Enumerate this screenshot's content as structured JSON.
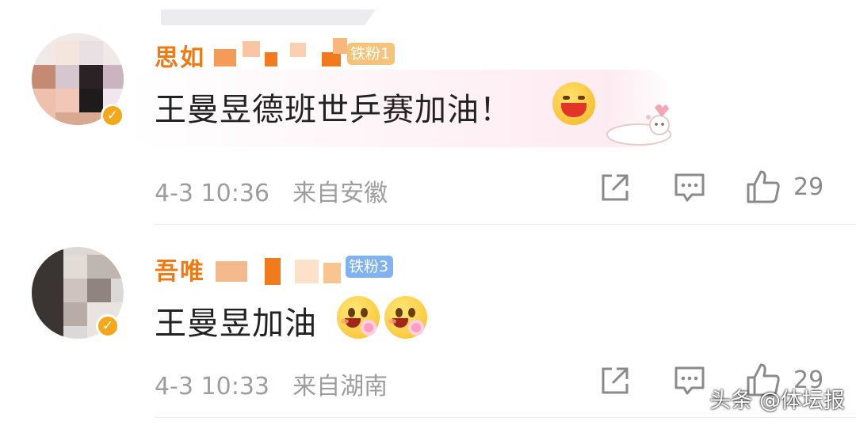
{
  "comments": [
    {
      "username_visible": "思如",
      "badge": "铁粉1",
      "text": "王曼昱德班世乒赛加油！",
      "time": "4-3 10:36",
      "location": "来自安徽",
      "likes": "29"
    },
    {
      "username_visible": "吾唯",
      "badge": "铁粉3",
      "text": "王曼昱加油",
      "time": "4-3 10:33",
      "location": "来自湖南",
      "likes": "29"
    }
  ],
  "watermark": "头条 @体坛报",
  "icons": {
    "share": "share-icon",
    "comment": "comment-icon",
    "like": "thumbs-up-icon",
    "verified": "verified-check-icon"
  },
  "colors": {
    "username": "#ef7a14",
    "badge": "#7fb2ee",
    "verified": "#f3a71a",
    "meta": "#9d9d9d"
  }
}
